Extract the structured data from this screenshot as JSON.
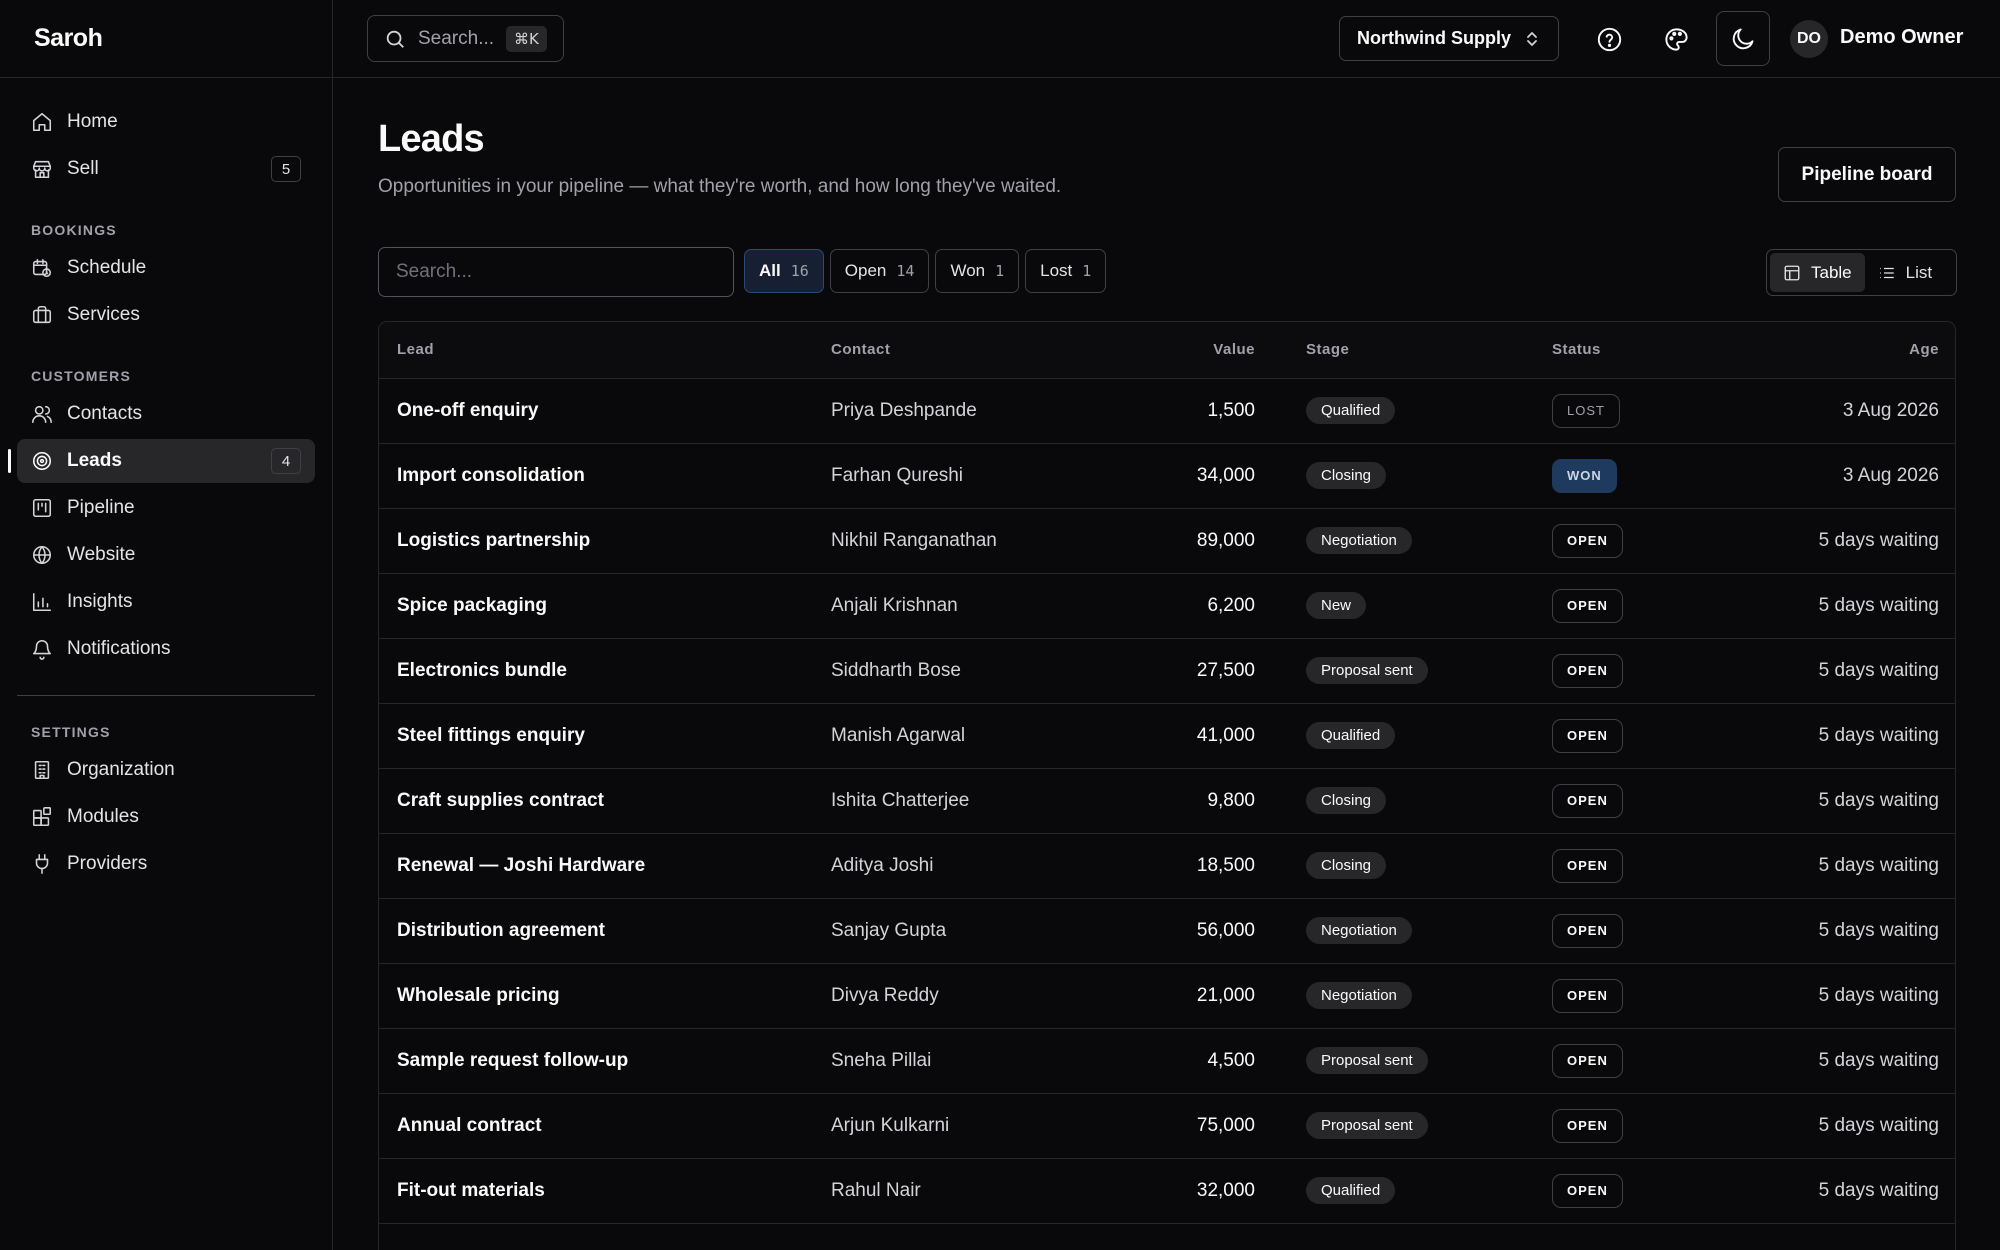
{
  "app": {
    "brand": "Saroh"
  },
  "topbar": {
    "search_placeholder": "Search...",
    "search_shortcut": "⌘K",
    "workspace": "Northwind Supply",
    "user_initials": "DO",
    "user_name": "Demo Owner"
  },
  "sidebar": {
    "main_items": [
      {
        "label": "Home",
        "icon": "home-icon"
      },
      {
        "label": "Sell",
        "icon": "store-icon",
        "badge": "5"
      }
    ],
    "bookings": {
      "title": "BOOKINGS",
      "items": [
        {
          "label": "Schedule",
          "icon": "calendar-clock-icon"
        },
        {
          "label": "Services",
          "icon": "briefcase-icon"
        }
      ]
    },
    "customers": {
      "title": "CUSTOMERS",
      "items": [
        {
          "label": "Contacts",
          "icon": "users-icon"
        },
        {
          "label": "Leads",
          "icon": "target-icon",
          "badge": "4",
          "active": true
        },
        {
          "label": "Pipeline",
          "icon": "kanban-icon"
        },
        {
          "label": "Website",
          "icon": "globe-icon"
        },
        {
          "label": "Insights",
          "icon": "bar-chart-icon"
        },
        {
          "label": "Notifications",
          "icon": "bell-icon"
        }
      ]
    },
    "settings": {
      "title": "SETTINGS",
      "items": [
        {
          "label": "Organization",
          "icon": "building-icon"
        },
        {
          "label": "Modules",
          "icon": "blocks-icon"
        },
        {
          "label": "Providers",
          "icon": "plug-icon"
        }
      ]
    }
  },
  "page": {
    "title": "Leads",
    "subtitle": "Opportunities in your pipeline — what they're worth, and how long they've waited.",
    "pipeline_button": "Pipeline board",
    "search_placeholder": "Search...",
    "filters": [
      {
        "label": "All",
        "count": "16",
        "active": true
      },
      {
        "label": "Open",
        "count": "14"
      },
      {
        "label": "Won",
        "count": "1"
      },
      {
        "label": "Lost",
        "count": "1"
      }
    ],
    "views": [
      {
        "label": "Table",
        "active": true
      },
      {
        "label": "List"
      }
    ]
  },
  "table": {
    "columns": {
      "lead": "Lead",
      "contact": "Contact",
      "value": "Value",
      "stage": "Stage",
      "status": "Status",
      "age": "Age"
    },
    "rows": [
      {
        "lead": "One-off enquiry",
        "contact": "Priya Deshpande",
        "value": "1,500",
        "stage": "Qualified",
        "status": "LOST",
        "age": "3 Aug 2026"
      },
      {
        "lead": "Import consolidation",
        "contact": "Farhan Qureshi",
        "value": "34,000",
        "stage": "Closing",
        "status": "WON",
        "age": "3 Aug 2026"
      },
      {
        "lead": "Logistics partnership",
        "contact": "Nikhil Ranganathan",
        "value": "89,000",
        "stage": "Negotiation",
        "status": "OPEN",
        "age": "5 days waiting"
      },
      {
        "lead": "Spice packaging",
        "contact": "Anjali Krishnan",
        "value": "6,200",
        "stage": "New",
        "status": "OPEN",
        "age": "5 days waiting"
      },
      {
        "lead": "Electronics bundle",
        "contact": "Siddharth Bose",
        "value": "27,500",
        "stage": "Proposal sent",
        "status": "OPEN",
        "age": "5 days waiting"
      },
      {
        "lead": "Steel fittings enquiry",
        "contact": "Manish Agarwal",
        "value": "41,000",
        "stage": "Qualified",
        "status": "OPEN",
        "age": "5 days waiting"
      },
      {
        "lead": "Craft supplies contract",
        "contact": "Ishita Chatterjee",
        "value": "9,800",
        "stage": "Closing",
        "status": "OPEN",
        "age": "5 days waiting"
      },
      {
        "lead": "Renewal — Joshi Hardware",
        "contact": "Aditya Joshi",
        "value": "18,500",
        "stage": "Closing",
        "status": "OPEN",
        "age": "5 days waiting"
      },
      {
        "lead": "Distribution agreement",
        "contact": "Sanjay Gupta",
        "value": "56,000",
        "stage": "Negotiation",
        "status": "OPEN",
        "age": "5 days waiting"
      },
      {
        "lead": "Wholesale pricing",
        "contact": "Divya Reddy",
        "value": "21,000",
        "stage": "Negotiation",
        "status": "OPEN",
        "age": "5 days waiting"
      },
      {
        "lead": "Sample request follow-up",
        "contact": "Sneha Pillai",
        "value": "4,500",
        "stage": "Proposal sent",
        "status": "OPEN",
        "age": "5 days waiting"
      },
      {
        "lead": "Annual contract",
        "contact": "Arjun Kulkarni",
        "value": "75,000",
        "stage": "Proposal sent",
        "status": "OPEN",
        "age": "5 days waiting"
      },
      {
        "lead": "Fit-out materials",
        "contact": "Rahul Nair",
        "value": "32,000",
        "stage": "Qualified",
        "status": "OPEN",
        "age": "5 days waiting"
      }
    ]
  }
}
